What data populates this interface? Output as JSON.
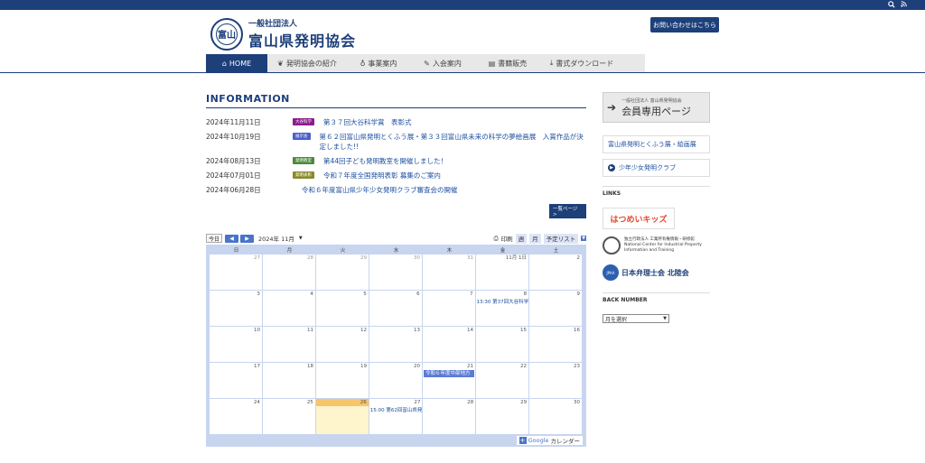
{
  "header": {
    "org_prefix": "一般社団法人",
    "org_name": "富山県発明協会",
    "seal_char": "富山",
    "contact": "お問い合わせはこちら"
  },
  "nav": [
    {
      "label": "HOME",
      "icon": "home-icon"
    },
    {
      "label": "発明協会の紹介",
      "icon": "leaf-icon"
    },
    {
      "label": "事業案内",
      "icon": "bulb-icon"
    },
    {
      "label": "入会案内",
      "icon": "edit-icon"
    },
    {
      "label": "書籍販売",
      "icon": "book-icon"
    },
    {
      "label": "書式ダウンロード",
      "icon": "download-icon"
    }
  ],
  "info": {
    "title": "INFORMATION",
    "more": "一覧ページ >",
    "items": [
      {
        "date": "2024年11月11日",
        "badge": "大谷科学",
        "badge_color": "#8a1d8a",
        "text": "第３７回大谷科学賞　表彰式"
      },
      {
        "date": "2024年10月19日",
        "badge": "展示会",
        "badge_color": "#4a5fc9",
        "text": "第６２回富山県発明とくふう展・第３３回富山県未来の科学の夢絵画展　入賞作品が決定しました!!"
      },
      {
        "date": "2024年08月13日",
        "badge": "発明教室",
        "badge_color": "#4a8a3a",
        "text": "第44回子ども発明教室を開催しました！"
      },
      {
        "date": "2024年07月01日",
        "badge": "発明表彰",
        "badge_color": "#8a8a2a",
        "text": "令和７年度全国発明表彰 募集のご案内"
      },
      {
        "date": "2024年06月28日",
        "badge": "",
        "badge_color": "",
        "text": "令和６年度富山県少年少女発明クラブ審査会の開催"
      }
    ]
  },
  "calendar": {
    "today_btn": "今日",
    "month": "2024年 11月",
    "print": "印刷",
    "tabs": [
      "週",
      "月",
      "予定リスト"
    ],
    "weekdays": [
      "日",
      "月",
      "火",
      "水",
      "木",
      "金",
      "土"
    ],
    "weeks": [
      [
        {
          "d": "27",
          "o": true
        },
        {
          "d": "28",
          "o": true
        },
        {
          "d": "29",
          "o": true
        },
        {
          "d": "30",
          "o": true
        },
        {
          "d": "31",
          "o": true
        },
        {
          "d": "11月 1日"
        },
        {
          "d": "2"
        }
      ],
      [
        {
          "d": "3"
        },
        {
          "d": "4"
        },
        {
          "d": "5"
        },
        {
          "d": "6"
        },
        {
          "d": "7"
        },
        {
          "d": "8",
          "evt": "13:30 第37回大谷科学"
        },
        {
          "d": "9"
        }
      ],
      [
        {
          "d": "10"
        },
        {
          "d": "11"
        },
        {
          "d": "12"
        },
        {
          "d": "13"
        },
        {
          "d": "14"
        },
        {
          "d": "15"
        },
        {
          "d": "16"
        }
      ],
      [
        {
          "d": "17"
        },
        {
          "d": "18"
        },
        {
          "d": "19"
        },
        {
          "d": "20"
        },
        {
          "d": "21",
          "bar": "令和６年度中部地方"
        },
        {
          "d": "22"
        },
        {
          "d": "23"
        }
      ],
      [
        {
          "d": "24"
        },
        {
          "d": "25"
        },
        {
          "d": "26",
          "today": true
        },
        {
          "d": "27",
          "evt": "15:00 第62回富山県発"
        },
        {
          "d": "28"
        },
        {
          "d": "29"
        },
        {
          "d": "30"
        }
      ]
    ],
    "google": "Google",
    "google_suffix": "カレンダー"
  },
  "sidebar": {
    "member_small": "一般社団法人 富山県発明協会",
    "member_main": "会員専用ページ",
    "links": [
      "富山県発明とくふう展・絵画展",
      "少年少女発明クラブ"
    ],
    "links_head": "LINKS",
    "hatsu": "はつめいキッズ",
    "inpit_text": "独立行政法人 工業所有権情報・研修館",
    "inpit_en1": "National Center for Industrial Property",
    "inpit_en2": "Information and Training",
    "jpaa_logo": "JPAA",
    "jpaa": "日本弁理士会 北陸会",
    "back_head": "BACK NUMBER",
    "select": "月を選択"
  }
}
